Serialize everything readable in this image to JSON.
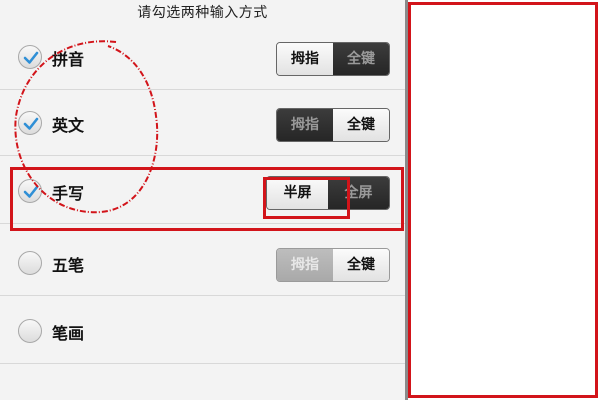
{
  "header": {
    "title": "请勾选两种输入方式"
  },
  "methods": [
    {
      "label": "拼音",
      "checked": true,
      "segment": {
        "left": "拇指",
        "right": "全键",
        "active": "left",
        "enabled": true
      }
    },
    {
      "label": "英文",
      "checked": true,
      "segment": {
        "left": "拇指",
        "right": "全键",
        "active": "right",
        "enabled": true
      }
    },
    {
      "label": "手写",
      "checked": true,
      "segment": {
        "left": "半屏",
        "right": "全屏",
        "active": "left",
        "enabled": true
      }
    },
    {
      "label": "五笔",
      "checked": false,
      "segment": {
        "left": "拇指",
        "right": "全键",
        "active": "right",
        "enabled": false
      }
    },
    {
      "label": "笔画",
      "checked": false
    }
  ],
  "colors": {
    "annotation_red": "#d2141a",
    "check_blue": "#2f8fd6"
  },
  "icons": {
    "checked": "check-icon",
    "unchecked": "empty-radio-icon"
  }
}
